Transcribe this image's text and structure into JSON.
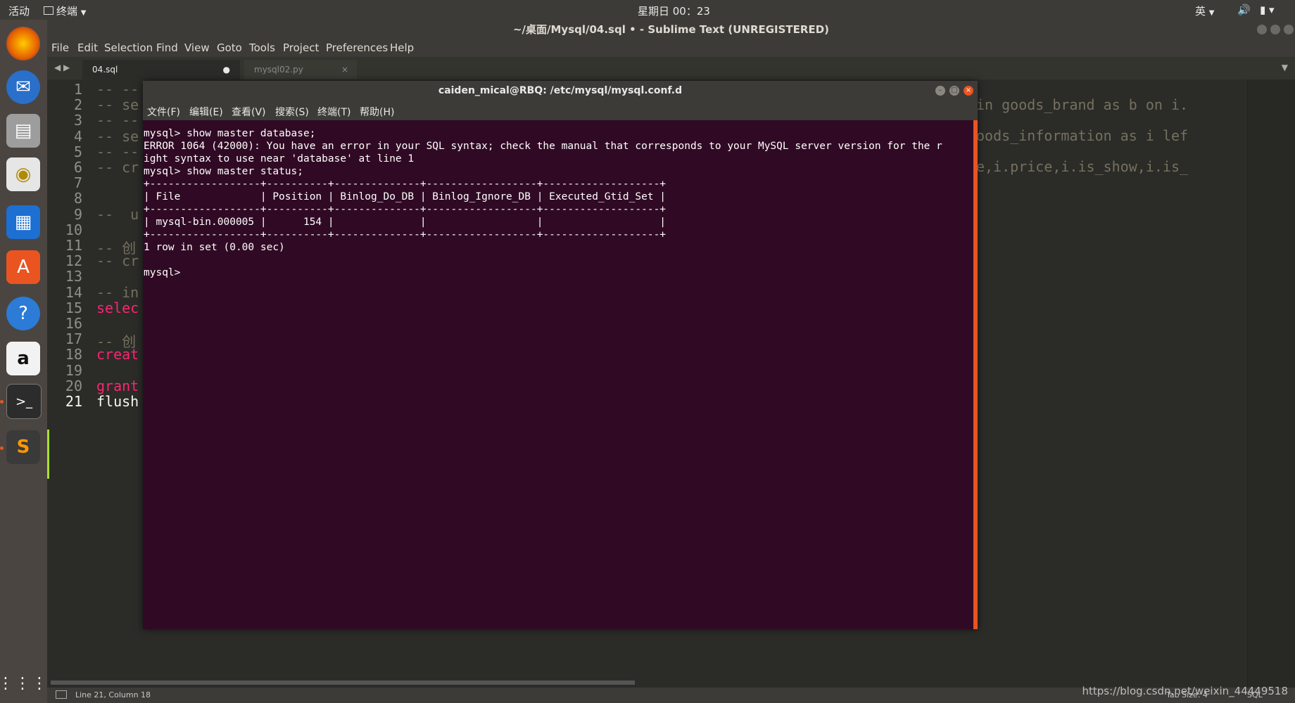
{
  "topbar": {
    "activities": "活动",
    "app_menu": "终端",
    "clock": "星期日 00：23",
    "input_method": "英",
    "volume_icon": "speaker-icon",
    "power_icon": "battery-icon"
  },
  "dock": {
    "items": [
      {
        "name": "firefox",
        "icon": "firefox-icon"
      },
      {
        "name": "thunderbird",
        "icon": "mail-icon"
      },
      {
        "name": "files",
        "icon": "files-icon"
      },
      {
        "name": "rhythmbox",
        "icon": "music-icon"
      },
      {
        "name": "writer",
        "icon": "document-icon"
      },
      {
        "name": "software",
        "icon": "software-center-icon"
      },
      {
        "name": "help",
        "icon": "help-icon"
      },
      {
        "name": "amazon",
        "icon": "amazon-icon"
      },
      {
        "name": "terminal",
        "icon": "terminal-icon"
      },
      {
        "name": "sublime",
        "icon": "sublime-icon"
      },
      {
        "name": "apps",
        "icon": "app-grid-icon"
      }
    ]
  },
  "sublime": {
    "title": "~/桌面/Mysql/04.sql • - Sublime Text (UNREGISTERED)",
    "menu": [
      "File",
      "Edit",
      "Selection",
      "Find",
      "View",
      "Goto",
      "Tools",
      "Project",
      "Preferences",
      "Help"
    ],
    "tabs": [
      {
        "label": "04.sql",
        "modified": "●"
      },
      {
        "label": "mysql02.py",
        "close": "×"
      }
    ],
    "lines": [
      {
        "num": "1",
        "text": "-- --",
        "cls": "cmt"
      },
      {
        "num": "2",
        "text": "-- se",
        "cls": "cmt"
      },
      {
        "num": "3",
        "text": "-- --",
        "cls": "cmt"
      },
      {
        "num": "4",
        "text": "-- se",
        "cls": "cmt"
      },
      {
        "num": "5",
        "text": "-- --",
        "cls": "cmt"
      },
      {
        "num": "6",
        "text": "-- cr",
        "cls": "cmt"
      },
      {
        "num": "7",
        "text": "",
        "cls": "cmt"
      },
      {
        "num": "8",
        "text": "",
        "cls": "cmt"
      },
      {
        "num": "9",
        "text": "--  u",
        "cls": "cmt"
      },
      {
        "num": "10",
        "text": "",
        "cls": "cmt"
      },
      {
        "num": "11",
        "text": "-- 创",
        "cls": "cmt"
      },
      {
        "num": "12",
        "text": "-- cr",
        "cls": "cmt"
      },
      {
        "num": "13",
        "text": "",
        "cls": "cmt"
      },
      {
        "num": "14",
        "text": "-- in",
        "cls": "cmt"
      },
      {
        "num": "15",
        "text": "selec",
        "cls": "kw"
      },
      {
        "num": "16",
        "text": "",
        "cls": "cmt"
      },
      {
        "num": "17",
        "text": "-- 创",
        "cls": "cmt"
      },
      {
        "num": "18",
        "text": "creat",
        "cls": "kw"
      },
      {
        "num": "19",
        "text": "",
        "cls": "cmt"
      },
      {
        "num": "20",
        "text": "grant",
        "cls": "kw"
      },
      {
        "num": "21",
        "text": "flush",
        "cls": "plain"
      }
    ],
    "right_fragments": [
      "in goods_brand as b on i.",
      "oods_information as i lef",
      "e,i.price,i.is_show,i.is_"
    ],
    "status": {
      "position": "Line 21, Column 18",
      "tab_size": "Tab Size: 4",
      "syntax": "SQL"
    }
  },
  "terminal": {
    "title": "caiden_mical@RBQ: /etc/mysql/mysql.conf.d",
    "menu": [
      "文件(F)",
      "编辑(E)",
      "查看(V)",
      "搜索(S)",
      "终端(T)",
      "帮助(H)"
    ],
    "lines": [
      "mysql> show master database;",
      "ERROR 1064 (42000): You have an error in your SQL syntax; check the manual that corresponds to your MySQL server version for the r",
      "ight syntax to use near 'database' at line 1",
      "mysql> show master status;",
      "+------------------+----------+--------------+------------------+-------------------+",
      "| File             | Position | Binlog_Do_DB | Binlog_Ignore_DB | Executed_Gtid_Set |",
      "+------------------+----------+--------------+------------------+-------------------+",
      "| mysql-bin.000005 |      154 |              |                  |                   |",
      "+------------------+----------+--------------+------------------+-------------------+",
      "1 row in set (0.00 sec)",
      "",
      "mysql> "
    ]
  },
  "watermark": "https://blog.csdn.net/weixin_44449518",
  "colors": {
    "terminal_bg": "#300a24",
    "accent": "#e95420",
    "keyword": "#f92672",
    "comment": "#75715e"
  }
}
